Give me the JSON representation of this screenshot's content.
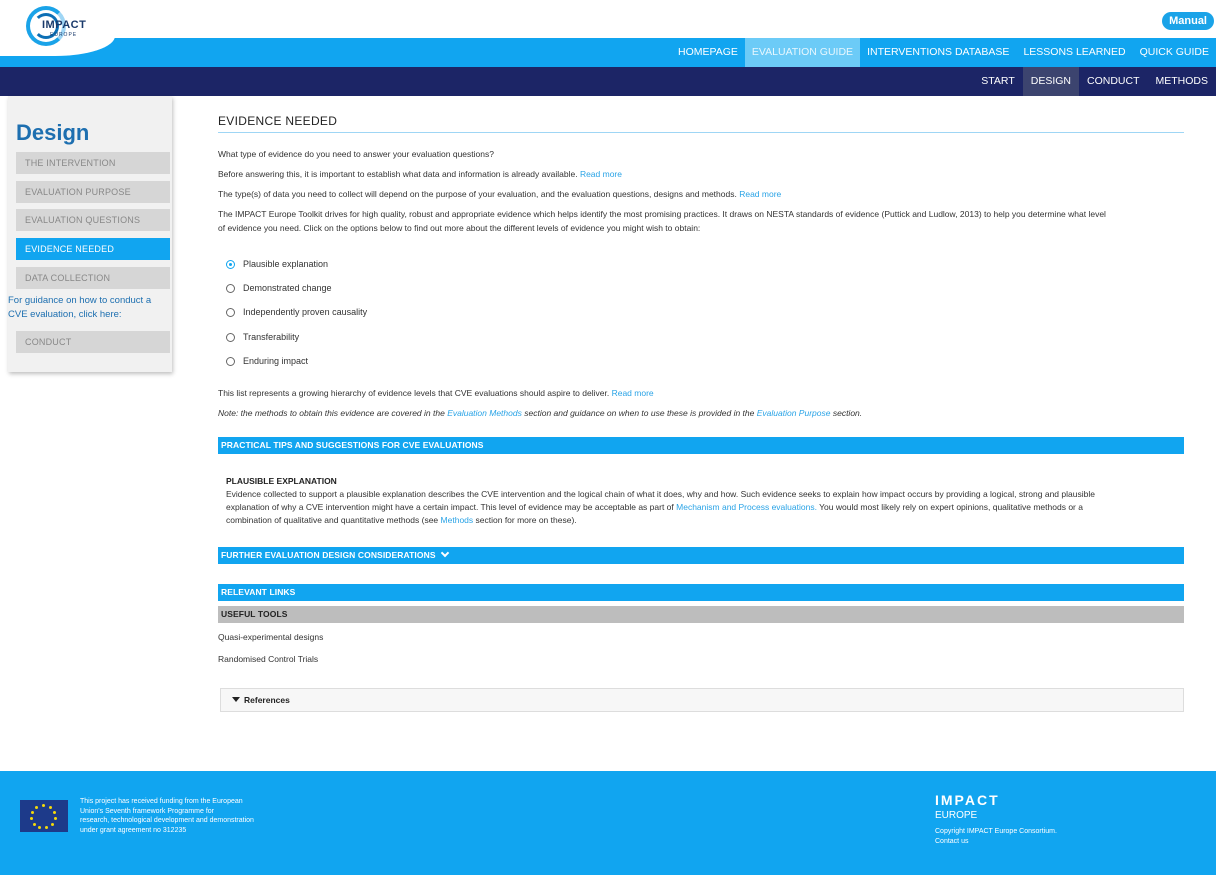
{
  "header": {
    "logo_text": "IMPACT",
    "logo_sub": "EUROPE",
    "manual_label": "Manual"
  },
  "nav": {
    "items": [
      "HOMEPAGE",
      "EVALUATION GUIDE",
      "INTERVENTIONS DATABASE",
      "LESSONS LEARNED",
      "QUICK GUIDE"
    ],
    "active": "EVALUATION GUIDE"
  },
  "subnav": {
    "items": [
      "START",
      "DESIGN",
      "CONDUCT",
      "METHODS"
    ],
    "active": "DESIGN"
  },
  "sidebar": {
    "title": "Design",
    "items": [
      "THE INTERVENTION",
      "EVALUATION PURPOSE",
      "EVALUATION QUESTIONS",
      "EVIDENCE NEEDED",
      "DATA COLLECTION"
    ],
    "active": "EVIDENCE NEEDED",
    "guidance": "For guidance on how to conduct a CVE evaluation, click here:",
    "conduct": "CONDUCT"
  },
  "main": {
    "title": "EVIDENCE NEEDED",
    "q": "What type of evidence do you need to answer your evaluation questions?",
    "p1": "Before answering this, it is important to establish what data and information is already available.",
    "p2": "The type(s) of data you need to collect will depend on the purpose of your evaluation, and the evaluation questions, designs and methods.",
    "read_more": "Read more",
    "p3a": "The IMPACT Europe Toolkit drives for high quality, robust and appropriate evidence which helps identify the most promising practices. It draws on NESTA standards of evidence (Puttick and Ludlow, 2013) to help you determine what level",
    "p3b": "of evidence you need. Click on the options below to find out more about the different levels of evidence you might wish to obtain:",
    "options": [
      "Plausible explanation",
      "Demonstrated change",
      "Independently proven causality",
      "Transferability",
      "Enduring impact"
    ],
    "selected": "Plausible explanation",
    "p4": "This list represents a growing hierarchy of evidence levels that CVE evaluations should aspire to deliver.",
    "note_a": "Note: the methods to obtain this evidence are covered in the",
    "note_link1": "Evaluation Methods",
    "note_b": "section and guidance on when to use these is provided in the",
    "note_link2": "Evaluation Purpose",
    "note_c": "section.",
    "tips_bar": "PRACTICAL TIPS AND SUGGESTIONS FOR CVE EVALUATIONS",
    "pe_title": "PLAUSIBLE EXPLANATION",
    "pe_1": "Evidence collected to support a plausible explanation describes the CVE intervention and the logical chain of what it does, why and how. Such evidence seeks to explain how impact occurs by providing a logical, strong and plausible",
    "pe_2a": "explanation of why a CVE intervention might have a certain impact. This level of evidence may be acceptable as part of",
    "pe_link1": "Mechanism and Process evaluations.",
    "pe_2b": "You would most likely rely on expert opinions, qualitative methods or a",
    "pe_3a": "combination of qualitative and quantitative methods (see",
    "pe_link2": "Methods",
    "pe_3b": "section for more on these).",
    "further_bar": "FURTHER EVALUATION DESIGN CONSIDERATIONS",
    "links_bar": "RELEVANT LINKS",
    "tools_bar": "USEFUL TOOLS",
    "tools": [
      "Quasi-experimental designs",
      "Randomised Control Trials"
    ],
    "references": "References"
  },
  "footer": {
    "funding": [
      "This project has received funding from the European",
      "Union's Seventh framework Programme for",
      "research, technological development and demonstration",
      "under grant agreement no 312235"
    ],
    "brand": "IMPACT",
    "brand_sub": "EUROPE",
    "copyright": "Copyright IMPACT Europe Consortium.",
    "contact": "Contact us"
  },
  "colors": {
    "accent": "#11a5f0",
    "navy": "#1c2566",
    "link": "#29a3e6"
  }
}
